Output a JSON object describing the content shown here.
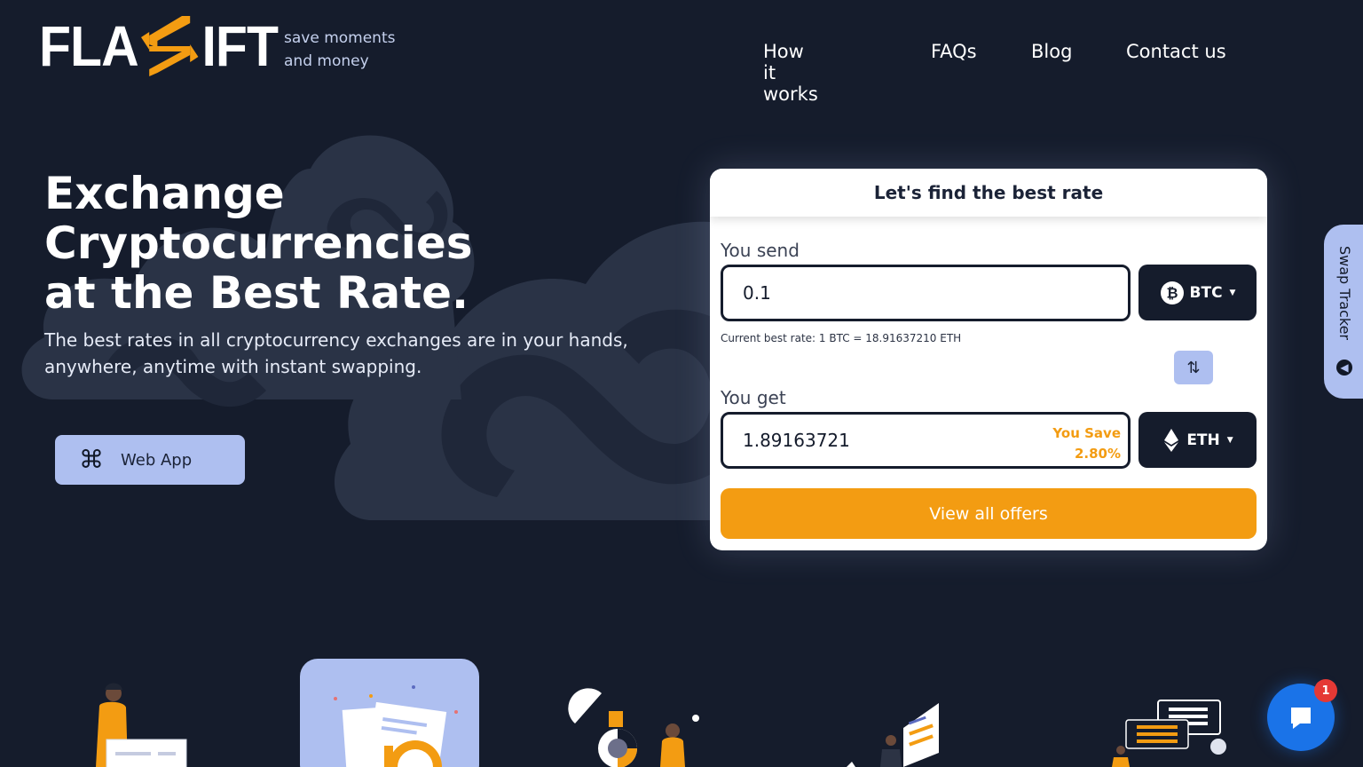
{
  "brand": {
    "logo_left": "FLA",
    "logo_right": "IFT",
    "tagline_line1": "save moments",
    "tagline_line2": "and money",
    "logo_icon": "s-arrows-logo-icon",
    "accent_color": "#f39c12"
  },
  "nav": {
    "items": [
      {
        "label": "How it works"
      },
      {
        "label": "FAQs"
      },
      {
        "label": "Blog"
      },
      {
        "label": "Contact us"
      }
    ]
  },
  "hero": {
    "title_line1": "Exchange",
    "title_line2": "Cryptocurrencies",
    "title_line3": "at the Best Rate.",
    "subtitle": "The best rates in all cryptocurrency exchanges are in your hands, anywhere, anytime with instant swapping.",
    "webapp_label": "Web App",
    "webapp_icon": "command-key-icon"
  },
  "widget": {
    "title": "Let's find the best rate",
    "send_label": "You send",
    "send_value": "0.1",
    "send_coin": "BTC",
    "send_coin_icon": "bitcoin-icon",
    "rate_text": "Current best rate: 1 BTC = 18.91637210 ETH",
    "swap_icon": "swap-arrows-icon",
    "get_label": "You get",
    "get_value": "1.89163721",
    "save_label": "You Save",
    "save_value": "2.80%",
    "get_coin": "ETH",
    "get_coin_icon": "ethereum-icon",
    "offers_button": "View all offers"
  },
  "side_tab": {
    "label": "Swap Tracker",
    "icon": "arrow-circle-icon"
  },
  "chat": {
    "icon": "chat-icon",
    "badge_count": "1"
  },
  "colors": {
    "background": "#151c2c",
    "accent_orange": "#f39c12",
    "light_blue": "#aebff0",
    "chat_blue": "#1a73e8"
  }
}
